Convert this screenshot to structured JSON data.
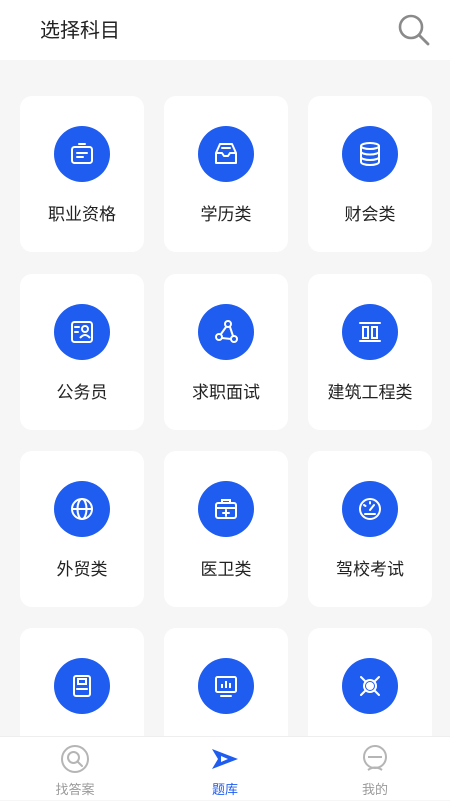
{
  "header": {
    "title": "选择科目",
    "search_icon": "search-icon"
  },
  "accent_color": "#1f5cf0",
  "subjects": [
    {
      "label": "职业资格",
      "icon": "id-badge-icon"
    },
    {
      "label": "学历类",
      "icon": "inbox-tray-icon"
    },
    {
      "label": "财会类",
      "icon": "database-stack-icon"
    },
    {
      "label": "公务员",
      "icon": "id-card-icon"
    },
    {
      "label": "求职面试",
      "icon": "network-nodes-icon"
    },
    {
      "label": "建筑工程类",
      "icon": "building-pillars-icon"
    },
    {
      "label": "外贸类",
      "icon": "globe-icon"
    },
    {
      "label": "医卫类",
      "icon": "medical-kit-icon"
    },
    {
      "label": "驾校考试",
      "icon": "speedometer-icon"
    },
    {
      "label": "",
      "icon": "document-icon"
    },
    {
      "label": "",
      "icon": "monitor-chart-icon"
    },
    {
      "label": "",
      "icon": "target-icon"
    }
  ],
  "tabbar": {
    "tabs": [
      {
        "label": "找答案",
        "icon": "search-icon",
        "active": false
      },
      {
        "label": "题库",
        "icon": "play-flag-icon",
        "active": true
      },
      {
        "label": "我的",
        "icon": "user-icon",
        "active": false
      }
    ]
  }
}
